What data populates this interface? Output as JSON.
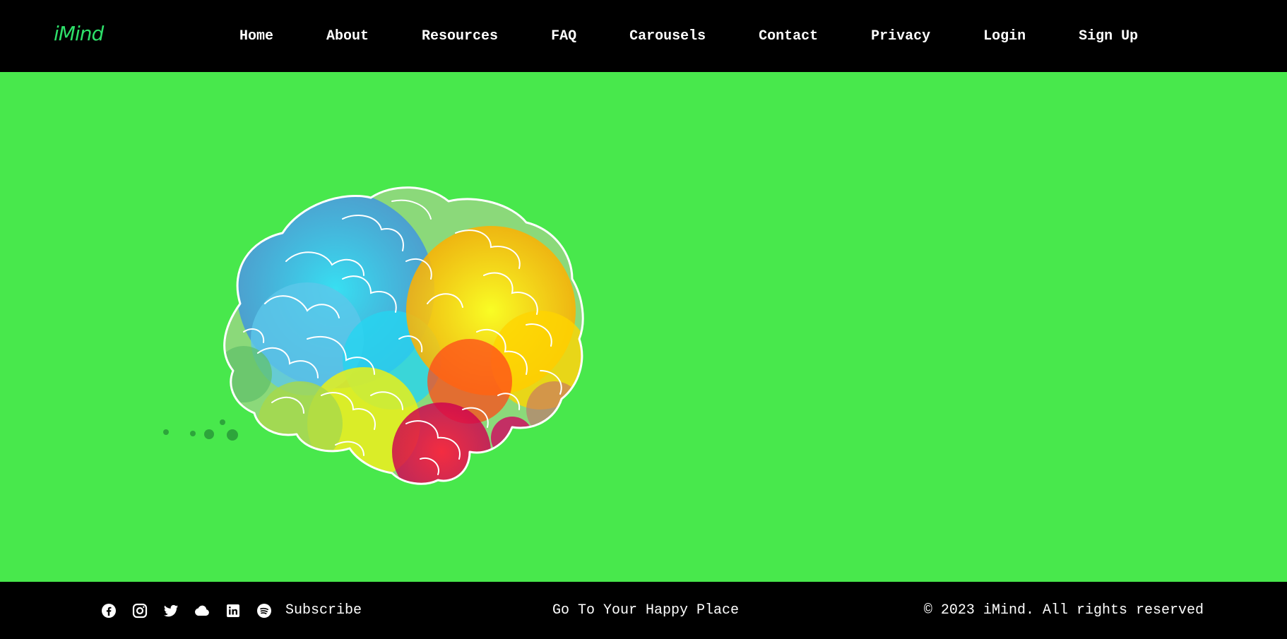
{
  "brand": {
    "logo": "iMind",
    "accent": "#2ee06a"
  },
  "nav": {
    "items": [
      {
        "label": "Home"
      },
      {
        "label": "About"
      },
      {
        "label": "Resources"
      },
      {
        "label": "FAQ"
      },
      {
        "label": "Carousels"
      },
      {
        "label": "Contact"
      },
      {
        "label": "Privacy"
      },
      {
        "label": "Login"
      },
      {
        "label": "Sign Up"
      }
    ]
  },
  "hero": {
    "background": "#48e84c",
    "image": "colorful-brain-illustration"
  },
  "footer": {
    "social_icons": [
      "facebook-icon",
      "instagram-icon",
      "twitter-icon",
      "cloud-icon",
      "linkedin-icon",
      "spotify-icon"
    ],
    "subscribe_label": "Subscribe",
    "tagline": "Go To Your Happy Place",
    "copyright": "© 2023 iMind. All rights reserved"
  }
}
